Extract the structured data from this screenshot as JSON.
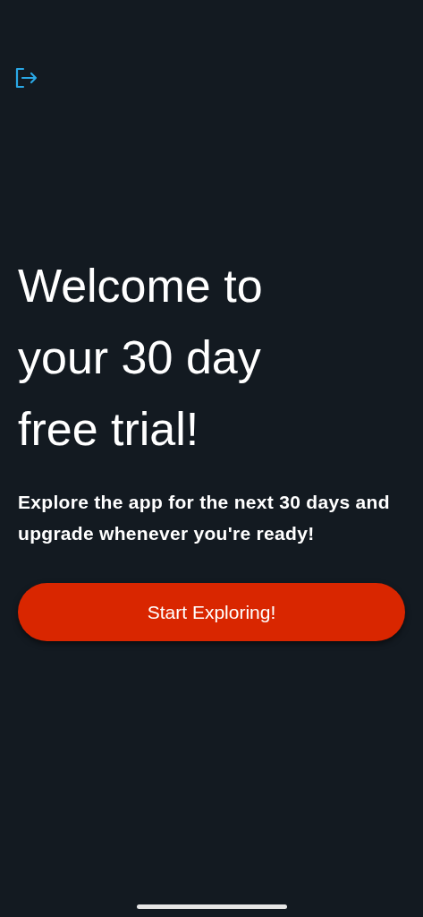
{
  "title": "Welcome to your 30 day free trial!",
  "description": "Explore the app for the next 30 days and upgrade whenever you're ready!",
  "button": {
    "label": "Start Exploring!"
  }
}
